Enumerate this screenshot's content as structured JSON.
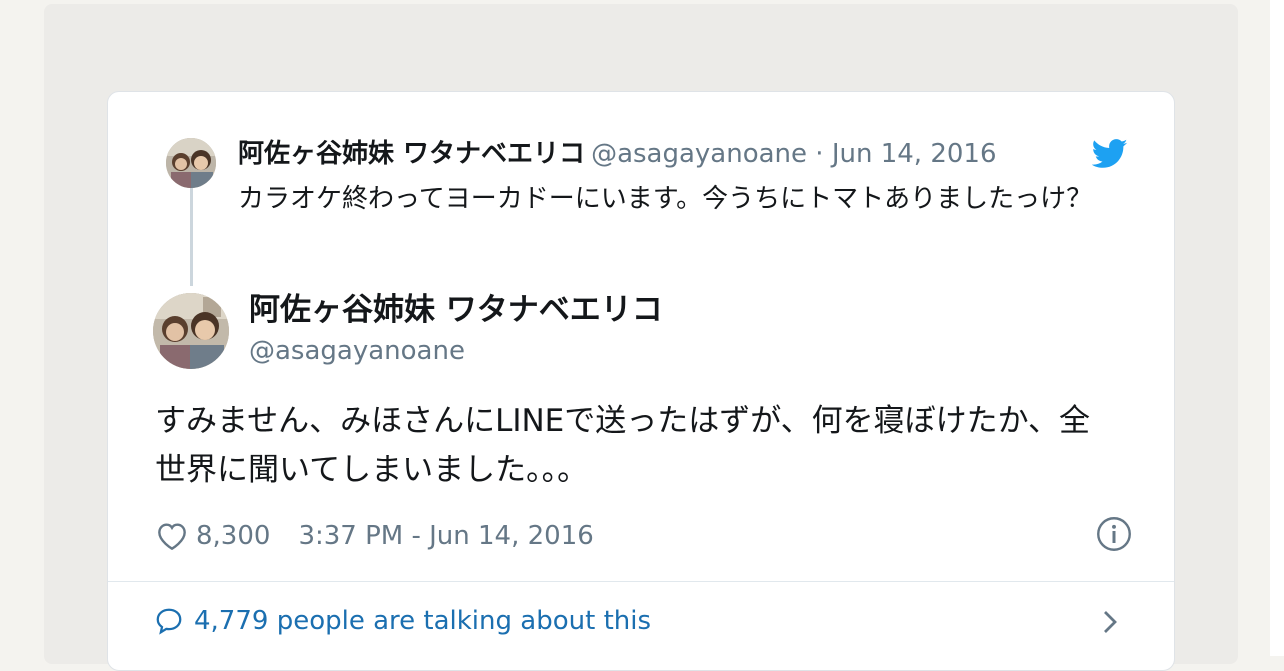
{
  "reply": {
    "name": "阿佐ヶ谷姉妹 ワタナベエリコ",
    "meta": "@asagayanoane · Jun 14, 2016",
    "text": "カラオケ終わってヨーカドーにいます。今うちにトマトありましたっけ？"
  },
  "tweet": {
    "name": "阿佐ヶ谷姉妹 ワタナベエリコ",
    "handle": "@asagayanoane",
    "text": "すみません、みほさんにLINEで送ったはずが、何を寝ぼけたか、全世界に聞いてしまいました。。。",
    "likes": "8,300",
    "timestamp": "3:37 PM - Jun 14, 2016"
  },
  "footer": {
    "talking_label": "4,779 people are talking about this"
  },
  "icons": {
    "brand": "twitter-bird-icon",
    "like": "heart-icon",
    "info": "info-icon",
    "reply": "speech-bubble-icon",
    "more": "chevron-right-icon"
  },
  "colors": {
    "twitter_blue": "#1da1f2",
    "link_blue": "#1b6fb0",
    "secondary_text": "#657786"
  }
}
